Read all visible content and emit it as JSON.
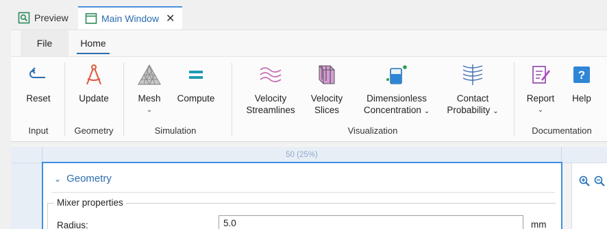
{
  "doc_tabs": {
    "preview": "Preview",
    "main": "Main Window",
    "close_glyph": "✕"
  },
  "ribbon": {
    "tabs": {
      "file": "File",
      "home": "Home"
    },
    "buttons": {
      "reset": "Reset",
      "update": "Update",
      "mesh": "Mesh",
      "compute": "Compute",
      "velocity_streamlines_1": "Velocity",
      "velocity_streamlines_2": "Streamlines",
      "velocity_slices_1": "Velocity",
      "velocity_slices_2": "Slices",
      "dimensionless_1": "Dimensionless",
      "dimensionless_2": "Concentration",
      "contact_1": "Contact",
      "contact_2": "Probability",
      "report": "Report",
      "help": "Help"
    },
    "groups": {
      "input": "Input",
      "geometry": "Geometry",
      "simulation": "Simulation",
      "visualization": "Visualization",
      "documentation": "Documentation"
    }
  },
  "content": {
    "ruler_label": "50 (25%)",
    "section_title": "Geometry",
    "fieldset_legend": "Mixer properties",
    "radius_label": "Radius:",
    "radius_value": "5.0",
    "radius_unit": "mm"
  },
  "colors": {
    "accent": "#2b6cb0",
    "frame_blue": "#3d8ee0",
    "help_blue": "#2f86d6",
    "icon_purple": "#b04fc4"
  }
}
